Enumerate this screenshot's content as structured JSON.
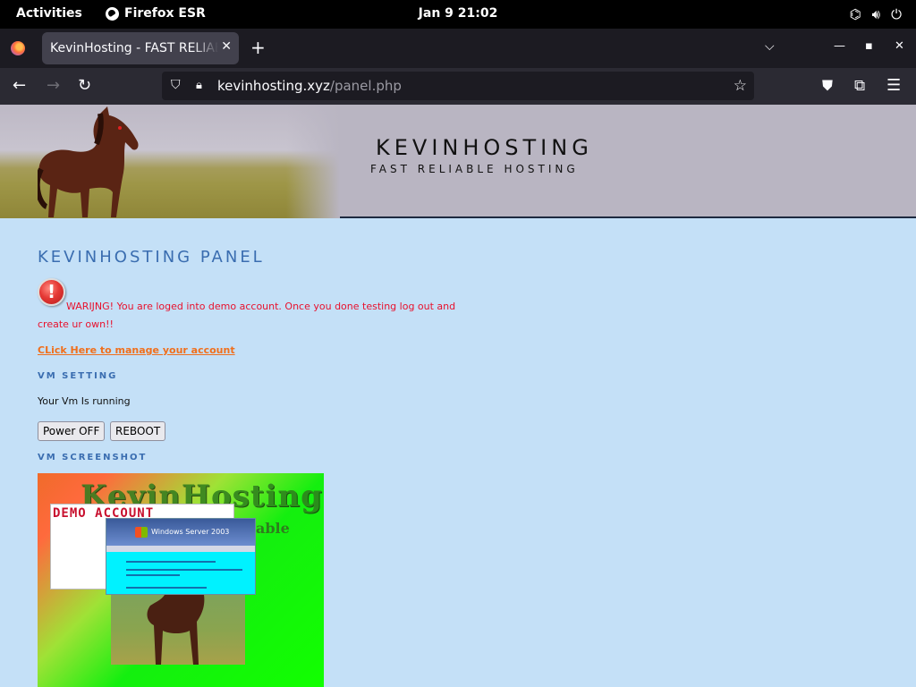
{
  "system_bar": {
    "activities": "Activities",
    "app_name": "Firefox ESR",
    "clock": "Jan 9  21:02",
    "tray_icons": [
      "network-icon",
      "volume-icon",
      "power-icon"
    ]
  },
  "browser": {
    "tab_title": "KevinHosting - FAST RELIABLE HOSTING",
    "new_tab": "+",
    "url_host": "kevinhosting.xyz",
    "url_path": "/panel.php"
  },
  "site": {
    "name": "KEVINHOSTING",
    "tagline": "FAST RELIABLE HOSTING",
    "panel_title": "KEVINHOSTING PANEL",
    "warning": "WARIJNG! You are loged into demo account. Once you done testing log out and create ur own!!",
    "manage_link": "CLick Here to manage your account",
    "vm_setting_heading": "VM SETTING",
    "vm_status": "Your Vm Is running",
    "power_off_label": "Power OFF",
    "reboot_label": "REBOOT",
    "vm_screenshot_heading": "VM SCREENSHOT",
    "screenshot": {
      "logo": "KevinHosting",
      "logo_sub": "able",
      "demo_label": "DEMO ACCOUNT",
      "windows_brand": "Windows Server 2003"
    }
  },
  "colors": {
    "page_bg": "#c4e0f7",
    "heading_blue": "#3a6db0",
    "warning_red": "#e8112d",
    "link_orange": "#f06f1c"
  }
}
